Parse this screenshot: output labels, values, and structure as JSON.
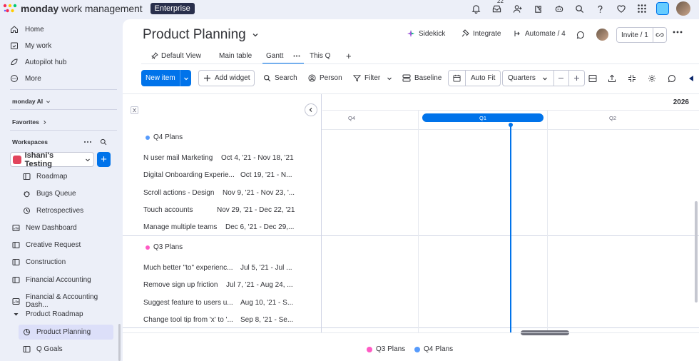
{
  "topbar": {
    "brand_bold": "monday",
    "brand_rest": " work management",
    "plan_badge": "Enterprise",
    "inbox_count": "22",
    "icons": [
      "bell-icon",
      "inbox-icon",
      "invite-members-icon",
      "apps-icon",
      "ai-bot-icon",
      "search-icon",
      "help-icon",
      "heart-icon",
      "app-switcher-icon",
      "workspace-avatar",
      "user-avatar"
    ]
  },
  "sidebar": {
    "nav": [
      {
        "label": "Home",
        "icon": "home-icon"
      },
      {
        "label": "My work",
        "icon": "calendar-check-icon"
      },
      {
        "label": "Autopilot hub",
        "icon": "autopilot-icon"
      },
      {
        "label": "More",
        "icon": "more-circle-icon"
      }
    ],
    "monday_ai": "monday AI",
    "favorites": "Favorites",
    "workspaces": "Workspaces",
    "workspace_name": "Ishani's Testing",
    "boards": [
      {
        "label": "Roadmap",
        "indent": true
      },
      {
        "label": "Bugs Queue",
        "indent": true
      },
      {
        "label": "Retrospectives",
        "indent": true
      },
      {
        "label": "New Dashboard",
        "indent": false
      },
      {
        "label": "Creative Request",
        "indent": false
      },
      {
        "label": "Construction",
        "indent": false
      },
      {
        "label": "Financial Accounting",
        "indent": false
      },
      {
        "label": "Financial & Accounting Dash...",
        "indent": false
      },
      {
        "label": "Product Roadmap",
        "indent": false
      },
      {
        "label": "Product Planning",
        "indent": true
      },
      {
        "label": "Q Goals",
        "indent": true
      }
    ]
  },
  "board": {
    "title": "Product Planning",
    "sidekick": "Sidekick",
    "integrate": "Integrate",
    "automate": "Automate / 4",
    "invite": "Invite / 1",
    "tabs": [
      "Default View",
      "Main table",
      "Gantt",
      "This Q"
    ],
    "active_tab": "Gantt"
  },
  "toolbar": {
    "new_item": "New item",
    "add_widget": "Add widget",
    "search": "Search",
    "person": "Person",
    "filter": "Filter",
    "baseline": "Baseline",
    "auto_fit": "Auto Fit",
    "quarters": "Quarters"
  },
  "gantt": {
    "year": "2026",
    "quarters": [
      "Q4",
      "Q1",
      "Q2"
    ],
    "current_quarter": "Q1",
    "groups": [
      {
        "name": "Q4 Plans",
        "color": "#579bfc",
        "items": [
          {
            "name": "N user mail Marketing",
            "dates": "Oct 4, '21 - Nov 18, '21"
          },
          {
            "name": "Digital Onboarding Experie...",
            "dates": "Oct 19, '21 - N..."
          },
          {
            "name": "Scroll actions - Design",
            "dates": "Nov 9, '21 - Nov 23, '..."
          },
          {
            "name": "Touch accounts",
            "dates": "Nov 29, '21 - Dec 22, '21"
          },
          {
            "name": "Manage multiple teams",
            "dates": "Dec 6, '21 - Dec 29,..."
          }
        ]
      },
      {
        "name": "Q3 Plans",
        "color": "#ff5ac4",
        "items": [
          {
            "name": "Much better \"to\" experienc...",
            "dates": "Jul 5, '21 - Jul ..."
          },
          {
            "name": "Remove sign up friction",
            "dates": "Jul 7, '21 - Aug 24, ..."
          },
          {
            "name": "Suggest feature to users u...",
            "dates": "Aug 10, '21 - S..."
          },
          {
            "name": "Change tool tip from 'x' to '...",
            "dates": "Sep 8, '21 - Se..."
          }
        ]
      }
    ]
  },
  "legend": [
    {
      "name": "Q3 Plans",
      "color": "#ff5ac4"
    },
    {
      "name": "Q4 Plans",
      "color": "#579bfc"
    }
  ],
  "colors": {
    "accent": "#0073ea",
    "sidebar_bg": "#eceff8",
    "active_item": "#dcdff9"
  }
}
